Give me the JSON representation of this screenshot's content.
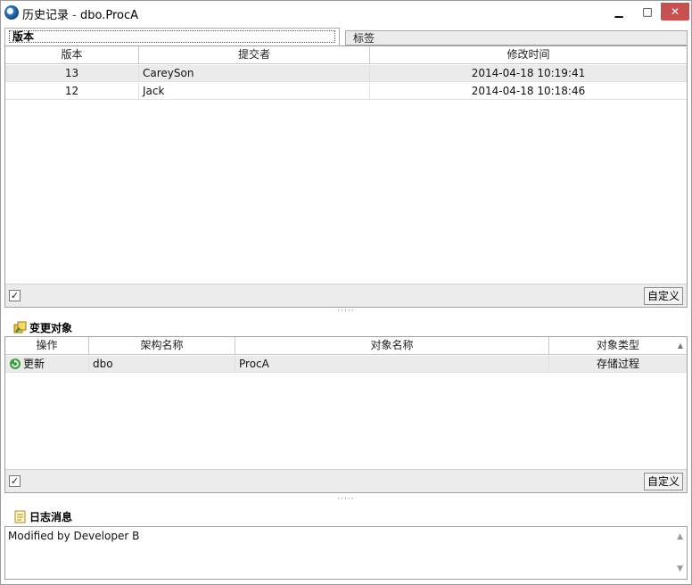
{
  "window": {
    "title_app": "历史记录",
    "title_sep": " - ",
    "title_object": "dbo.ProcA",
    "min_glyph": "▁",
    "max_glyph": "□",
    "close_glyph": "✕"
  },
  "tabs": [
    {
      "label": "版本"
    },
    {
      "label": "标签"
    }
  ],
  "versions": {
    "columns": [
      "版本",
      "提交者",
      "修改时间"
    ],
    "rows": [
      {
        "version": "13",
        "committer": "CareySon",
        "time": "2014-04-18 10:19:41"
      },
      {
        "version": "12",
        "committer": "Jack",
        "time": "2014-04-18 10:18:46"
      }
    ],
    "check_glyph": "✓",
    "customize_label": "自定义"
  },
  "splitter_glyph": "·····",
  "changed_objects": {
    "title": "变更对象",
    "columns": [
      "操作",
      "架构名称",
      "对象名称",
      "对象类型"
    ],
    "sort_glyph": "▲",
    "rows": [
      {
        "operation": "更新",
        "schema": "dbo",
        "object": "ProcA",
        "type": "存储过程"
      }
    ],
    "check_glyph": "✓",
    "customize_label": "自定义"
  },
  "log": {
    "title": "日志消息",
    "message": "Modified by Developer B",
    "scroll_up_glyph": "▲",
    "scroll_down_glyph": "▼"
  }
}
